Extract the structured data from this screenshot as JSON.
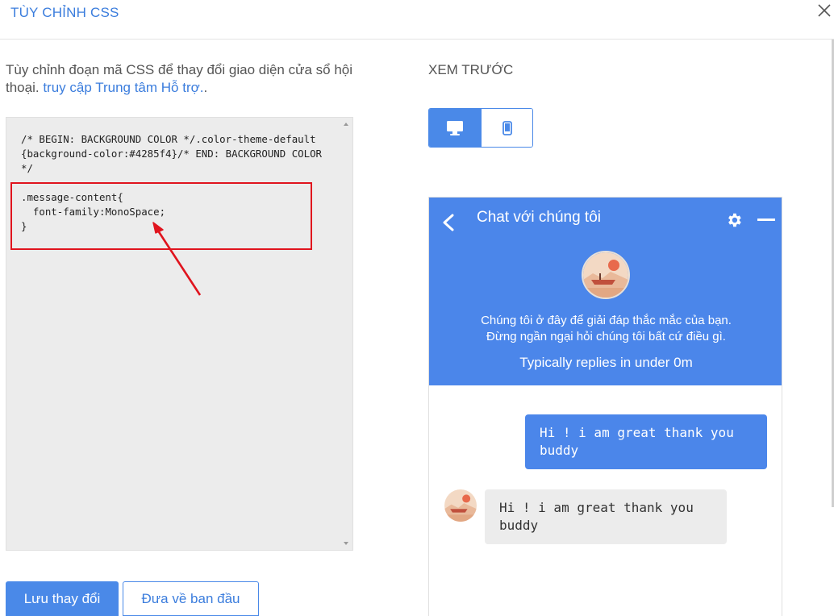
{
  "header": {
    "title": "TÙY CHỈNH CSS"
  },
  "left": {
    "description_text": "Tùy chỉnh đoạn mã CSS để thay đổi giao diện cửa sổ hội thoại. ",
    "description_link": "truy cập Trung tâm Hỗ trợ.",
    "description_suffix": ".",
    "css_code": "/* BEGIN: BACKGROUND COLOR */.color-theme-default{background-color:#4285f4}/* END: BACKGROUND COLOR */\n\n.message-content{\n  font-family:MonoSpace;\n}",
    "save_label": "Lưu thay đổi",
    "reset_label": "Đưa về ban đầu"
  },
  "preview": {
    "label": "XEM TRƯỚC",
    "device_desktop_icon": "monitor-icon",
    "device_mobile_icon": "phone-icon"
  },
  "widget": {
    "title": "Chat với chúng tôi",
    "subtitle_line1": "Chúng tôi ở đây để giải đáp thắc mắc của bạn.",
    "subtitle_line2": "Đừng ngần ngại hỏi chúng tôi bất cứ điều gì.",
    "reply_time": "Typically replies in under 0m",
    "messages": [
      {
        "from": "visitor",
        "text": "Hi ! i am great thank you buddy"
      },
      {
        "from": "agent",
        "text": "Hi ! i am great thank you buddy"
      }
    ],
    "theme_color": "#4b86ea"
  },
  "colors": {
    "accent": "#3b7ddd",
    "button": "#4a89e8",
    "highlight": "#e0141e",
    "editor_bg": "#ececec"
  }
}
